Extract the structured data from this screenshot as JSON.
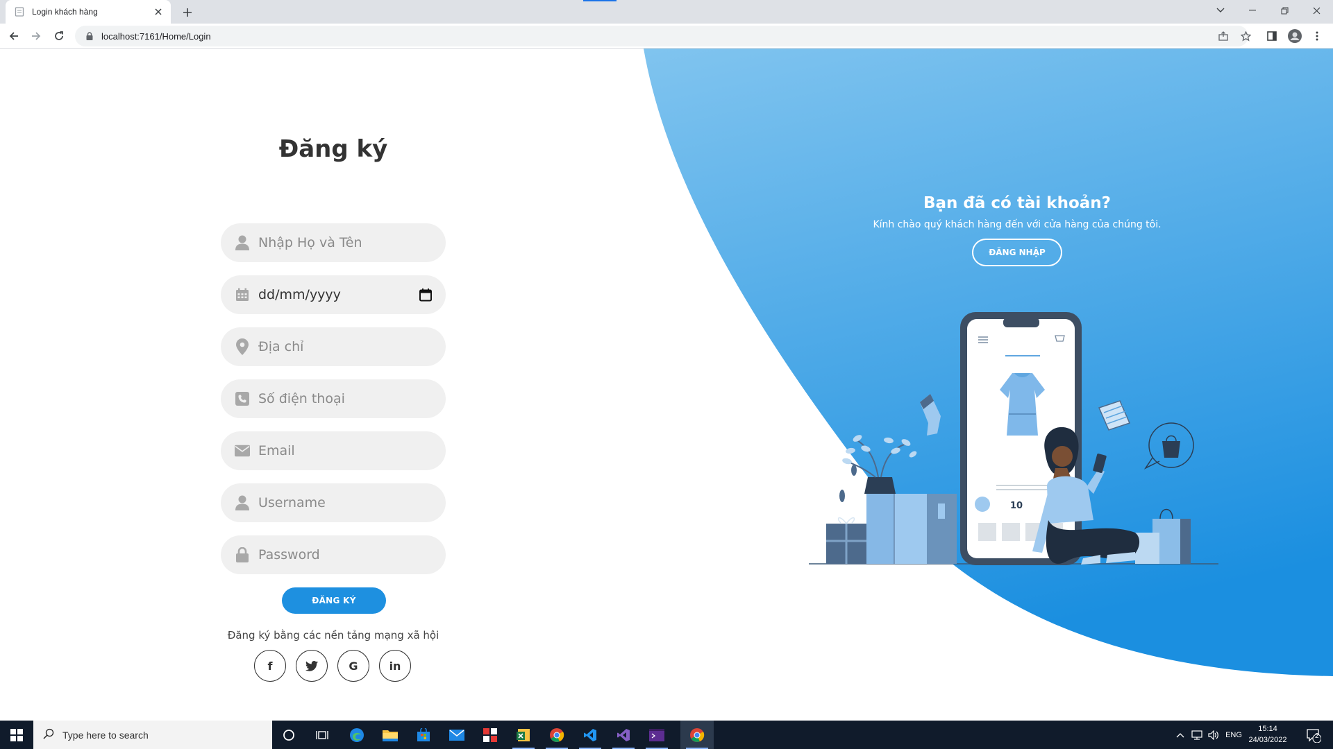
{
  "browser": {
    "tab_title": "Login khách hàng",
    "url": "localhost:7161/Home/Login"
  },
  "form": {
    "title": "Đăng ký",
    "fields": {
      "fullname_placeholder": "Nhập Họ và Tên",
      "dob_value": "dd/mm/yyyy",
      "address_placeholder": "Địa chỉ",
      "phone_placeholder": "Số điện thoại",
      "email_placeholder": "Email",
      "username_placeholder": "Username",
      "password_placeholder": "Password"
    },
    "register_button": "ĐĂNG KÝ",
    "social_text": "Đăng ký bằng các nền tảng mạng xã hội",
    "socials": {
      "facebook": "f",
      "google": "G",
      "linkedin": "in"
    }
  },
  "right_panel": {
    "title": "Bạn đã có tài khoản?",
    "subtitle": "Kính chào quý khách hàng đến với cửa hàng của chúng tôi.",
    "login_button": "ĐĂNG NHẬP",
    "phone_price": "10"
  },
  "taskbar": {
    "search_placeholder": "Type here to search",
    "language": "ENG",
    "time": "15:14",
    "date": "24/03/2022",
    "notifications": "2"
  },
  "colors": {
    "accent": "#1e90e0",
    "panel_light": "#7bc1ee",
    "panel_dark": "#1b8fe0",
    "field_bg": "#f0f0f0"
  }
}
